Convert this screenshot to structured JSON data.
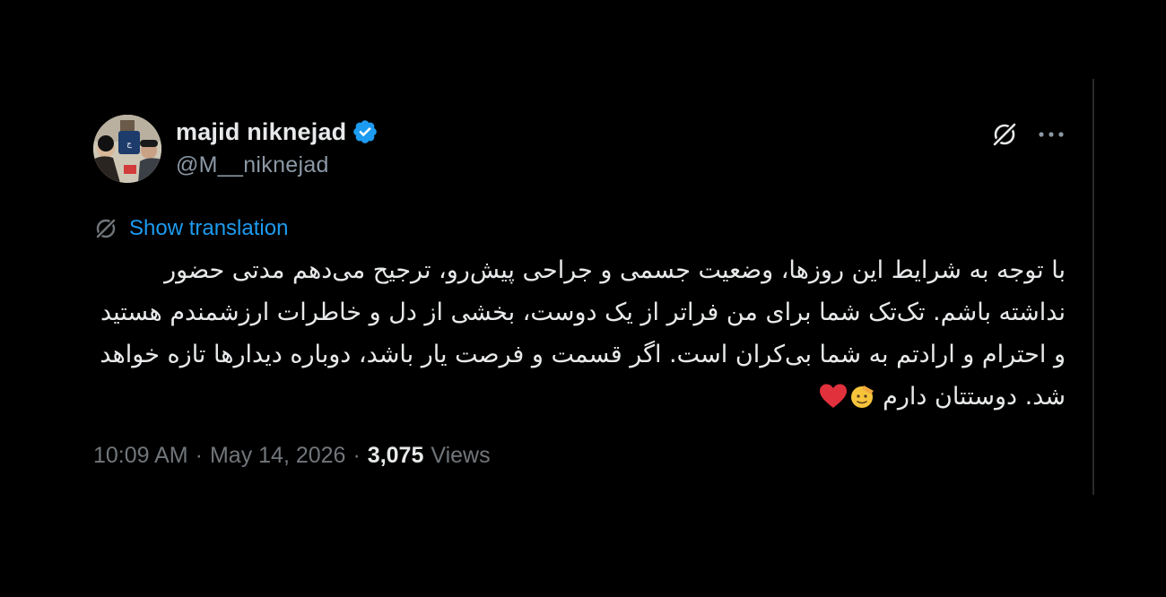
{
  "author": {
    "display_name": "majid niknejad",
    "handle": "@M__niknejad",
    "verified": true,
    "verified_color": "#1d9bf0",
    "avatar_icon": "avatar-photo"
  },
  "header_actions": {
    "grok_icon": "grok-icon",
    "more_icon": "more-icon"
  },
  "translation": {
    "icon": "translate-icon",
    "label": "Show translation"
  },
  "tweet": {
    "text": "با توجه به شرایط این روزها، وضعیت جسمی و جراحی پیش‌رو، ترجیح می‌دهم مدتی حضور نداشته باشم. تک‌تک شما برای من فراتر از یک دوست، بخشی از دل و خاطرات ارزشمندم هستید و احترام و ارادتم به شما بی‌کران است. اگر قسمت و فرصت یار باشد، دوباره دیدارها تازه خواهد شد. دوستتان دارم",
    "emojis": [
      "saluting-face",
      "red-heart"
    ]
  },
  "meta": {
    "time": "10:09 AM",
    "date": "May 14, 2026",
    "separator": "·",
    "views_count": "3,075",
    "views_label": "Views"
  },
  "colors": {
    "background": "#000000",
    "text": "#e7e9ea",
    "secondary": "#71767b",
    "link": "#1d9bf0"
  }
}
